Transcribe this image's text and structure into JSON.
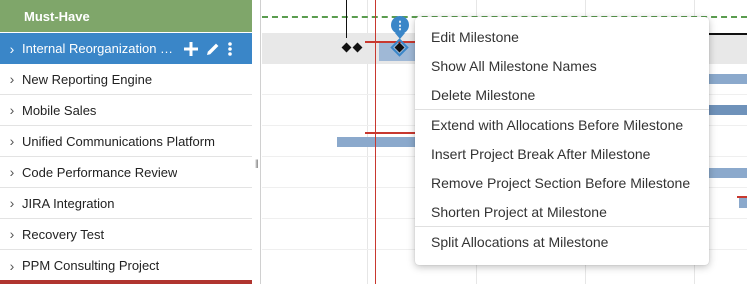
{
  "group": {
    "label": "Must-Have"
  },
  "projects": [
    {
      "label": "Internal Reorganization P...",
      "selected": true
    },
    {
      "label": "New Reporting Engine"
    },
    {
      "label": "Mobile Sales"
    },
    {
      "label": "Unified Communications Platform"
    },
    {
      "label": "Code Performance Review"
    },
    {
      "label": "JIRA Integration"
    },
    {
      "label": "Recovery Test"
    },
    {
      "label": "PPM Consulting Project"
    }
  ],
  "row_actions": {
    "add_icon": "plus-icon",
    "edit_icon": "pencil-icon",
    "more_icon": "kebab-icon"
  },
  "context_menu": {
    "items": [
      {
        "label": "Edit Milestone"
      },
      {
        "label": "Show All Milestone Names"
      },
      {
        "label": "Delete Milestone"
      },
      {
        "label": "Extend with Allocations Before Milestone"
      },
      {
        "label": "Insert Project Break After Milestone"
      },
      {
        "label": "Remove Project Section Before Milestone"
      },
      {
        "label": "Shorten Project at Milestone"
      },
      {
        "label": "Split Allocations at Milestone"
      }
    ]
  },
  "colors": {
    "group_header": "#7fa66a",
    "selected_row": "#3a86c8",
    "bar": "#8ba9cc",
    "today_line": "#c8382f",
    "dashed_line": "#5a9c4f"
  }
}
